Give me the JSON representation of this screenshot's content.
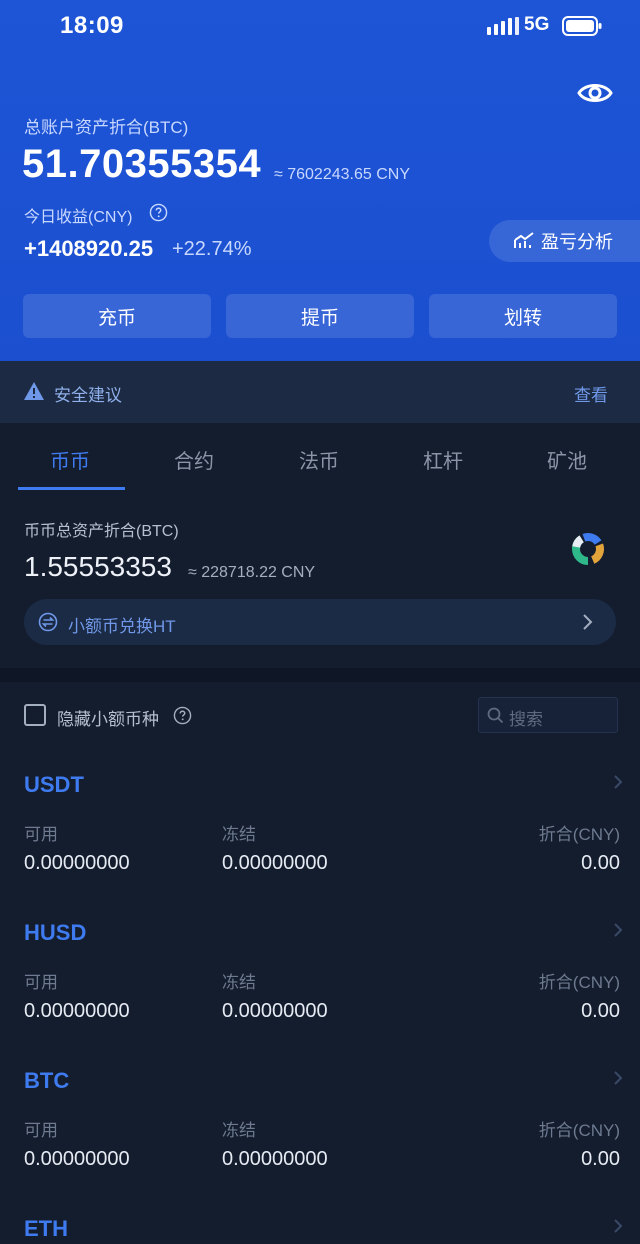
{
  "status_bar": {
    "time": "18:09",
    "network": "5G"
  },
  "account": {
    "total_label": "总账户资产折合(BTC)",
    "total_value": "51.70355354",
    "total_cny": "≈ 7602243.65 CNY",
    "today_label": "今日收益(CNY)",
    "today_value": "+1408920.25",
    "today_pct": "+22.74%",
    "pnl_button": "盈亏分析"
  },
  "actions": {
    "deposit": "充币",
    "withdraw": "提币",
    "transfer": "划转"
  },
  "safety": {
    "text": "安全建议",
    "link": "查看"
  },
  "tabs": [
    "币币",
    "合约",
    "法币",
    "杠杆",
    "矿池"
  ],
  "sub_account": {
    "label": "币币总资产折合(BTC)",
    "value": "1.55553353",
    "cny": "≈ 228718.22 CNY",
    "exchange_text": "小额币兑换HT"
  },
  "filter": {
    "hide_label": "隐藏小额币种",
    "search_placeholder": "搜索"
  },
  "columns": {
    "available": "可用",
    "frozen": "冻结",
    "value_cny": "折合(CNY)"
  },
  "assets": [
    {
      "name": "USDT",
      "available": "0.00000000",
      "frozen": "0.00000000",
      "cny": "0.00"
    },
    {
      "name": "HUSD",
      "available": "0.00000000",
      "frozen": "0.00000000",
      "cny": "0.00"
    },
    {
      "name": "BTC",
      "available": "0.00000000",
      "frozen": "0.00000000",
      "cny": "0.00"
    },
    {
      "name": "ETH",
      "available": "",
      "frozen": "",
      "cny": ""
    }
  ],
  "colors": {
    "brand_blue": "#1d55d6",
    "accent": "#3f7bf0",
    "background": "#141d2e"
  },
  "icons": [
    "eye-icon",
    "help-icon",
    "chart-trend-icon",
    "warning-icon",
    "donut-chart-icon",
    "swap-icon",
    "chevron-right-icon",
    "search-icon"
  ]
}
